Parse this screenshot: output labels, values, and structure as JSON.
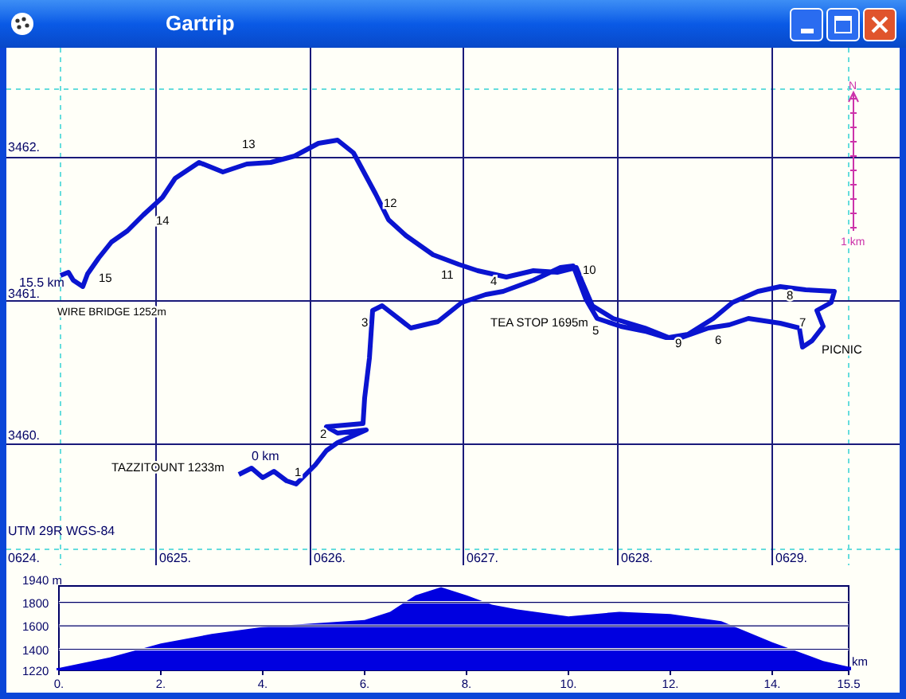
{
  "window": {
    "title": "Gartrip"
  },
  "map": {
    "northing_labels": [
      "3462.",
      "3461.",
      "3460."
    ],
    "datum": "UTM 29R WGS-84",
    "easting_labels": [
      "0624.",
      "0625.",
      "0626.",
      "0627.",
      "0628.",
      "0629."
    ],
    "start_marker": "0 km",
    "end_marker": "15.5 km",
    "place_labels": [
      "TAZZITOUNT 1233m",
      "WIRE BRIDGE 1252m",
      "TEA STOP 1695m",
      "PICNIC"
    ],
    "km_markers": [
      "1",
      "2",
      "3",
      "4",
      "5",
      "6",
      "7",
      "8",
      "9",
      "10",
      "11",
      "12",
      "13",
      "14",
      "15"
    ],
    "north_arrow": {
      "north_label": "N",
      "scale_label": "1 km"
    }
  },
  "profile": {
    "chart_data": {
      "type": "area",
      "xlabel": "km",
      "x": [
        0,
        1,
        2,
        3,
        4,
        5,
        6,
        6.5,
        7,
        7.5,
        8,
        8.5,
        9,
        10,
        11,
        12,
        13,
        14,
        15,
        15.5
      ],
      "grid": true,
      "series": [
        {
          "color": "#0000e0",
          "values": [
            1240,
            1330,
            1450,
            1530,
            1590,
            1620,
            1650,
            1720,
            1860,
            1930,
            1860,
            1780,
            1740,
            1680,
            1720,
            1700,
            1640,
            1460,
            1300,
            1250
          ]
        }
      ],
      "ylim": [
        1220,
        1940
      ],
      "xlim": [
        0,
        15.5
      ],
      "yticks": [
        {
          "value": 1220,
          "label": "1220"
        },
        {
          "value": 1400,
          "label": "1400"
        },
        {
          "value": 1600,
          "label": "1600"
        },
        {
          "value": 1800,
          "label": "1800"
        },
        {
          "value": 1940,
          "label": "1940 m"
        }
      ],
      "xticks": [
        {
          "value": 0,
          "label": "0."
        },
        {
          "value": 2,
          "label": "2."
        },
        {
          "value": 4,
          "label": "4."
        },
        {
          "value": 6,
          "label": "6."
        },
        {
          "value": 8,
          "label": "8."
        },
        {
          "value": 10,
          "label": "10."
        },
        {
          "value": 12,
          "label": "12."
        },
        {
          "value": 14,
          "label": "14."
        },
        {
          "value": 15.5,
          "label": "15.5"
        }
      ]
    }
  }
}
